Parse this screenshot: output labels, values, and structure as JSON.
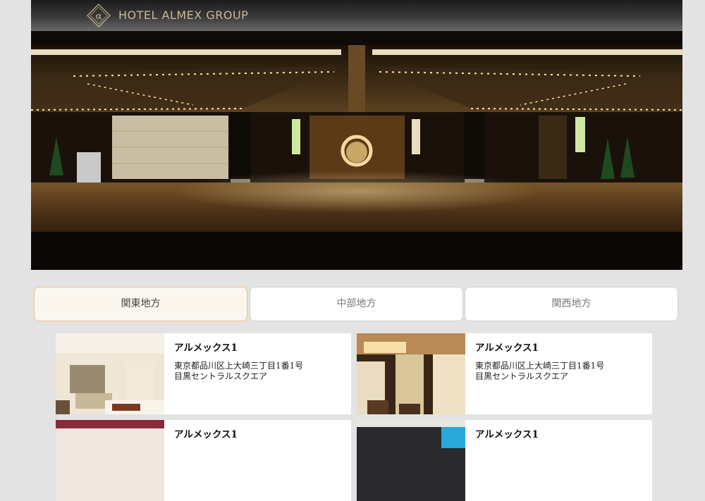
{
  "header": {
    "brand": "HOTEL ALMEX GROUP",
    "logo_glyph": "α",
    "background": "#2c2c2c",
    "brand_color": "#c9b895"
  },
  "hero": {
    "description_icon": "hotel-entrance-photo"
  },
  "tabs": [
    {
      "label": "関東地方",
      "active": true
    },
    {
      "label": "中部地方",
      "active": false
    },
    {
      "label": "関西地方",
      "active": false
    }
  ],
  "cards": [
    {
      "name": "アルメックス1",
      "address_line1": "東京都品川区上大崎三丁目1番1号",
      "address_line2": "目黒セントラルスクエア"
    },
    {
      "name": "アルメックス1",
      "address_line1": "東京都品川区上大崎三丁目1番1号",
      "address_line2": "目黒セントラルスクエア"
    },
    {
      "name": "アルメックス1",
      "address_line1": "",
      "address_line2": ""
    },
    {
      "name": "アルメックス1",
      "address_line1": "",
      "address_line2": ""
    }
  ],
  "colors": {
    "page_bg": "#e3e3e3",
    "active_tab_bg": "#fbf6ee",
    "active_tab_border": "#f0c089"
  }
}
